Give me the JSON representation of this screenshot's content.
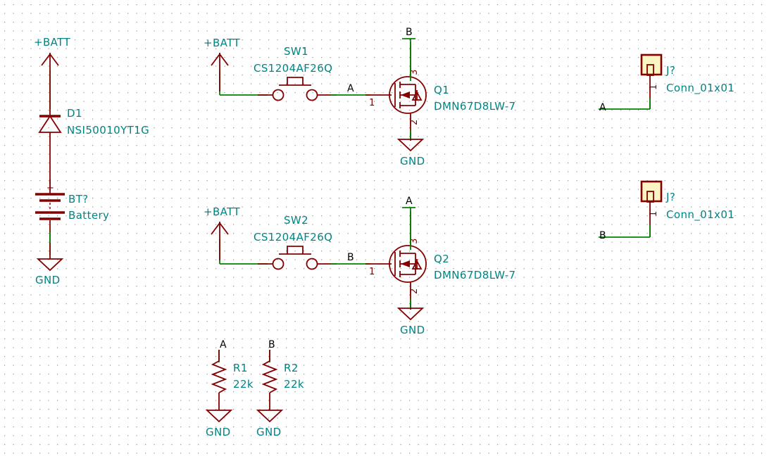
{
  "document": {
    "type": "schematic",
    "title": "KiCad Schematic Canvas",
    "background": "#ffffff",
    "grid_color": "#9a9a9a",
    "colors": {
      "component_text": "#008484",
      "symbol_outline": "#840000",
      "wire": "#008400",
      "label_text": "#000000",
      "pin_number": "#840000",
      "connector_fill": "#fbf5c4"
    }
  },
  "power_symbols": [
    {
      "name": "batt-1",
      "label": "+BATT"
    },
    {
      "name": "batt-2",
      "label": "+BATT"
    },
    {
      "name": "batt-3",
      "label": "+BATT"
    },
    {
      "name": "gnd-battery",
      "label": "GND"
    },
    {
      "name": "gnd-q1",
      "label": "GND"
    },
    {
      "name": "gnd-q2",
      "label": "GND"
    },
    {
      "name": "gnd-r1",
      "label": "GND"
    },
    {
      "name": "gnd-r2",
      "label": "GND"
    }
  ],
  "components": [
    {
      "id": "D1",
      "reference": "D1",
      "value": "NSI50010YT1G",
      "kind": "diode"
    },
    {
      "id": "BT1",
      "reference": "BT?",
      "value": "Battery",
      "kind": "battery",
      "polarity_marker": "+"
    },
    {
      "id": "SW1",
      "reference": "SW1",
      "value": "CS1204AF26Q",
      "kind": "push-button"
    },
    {
      "id": "SW2",
      "reference": "SW2",
      "value": "CS1204AF26Q",
      "kind": "push-button"
    },
    {
      "id": "Q1",
      "reference": "Q1",
      "value": "DMN67D8LW-7",
      "kind": "n-mosfet",
      "pins": {
        "gate": "1",
        "source": "2",
        "drain": "3"
      }
    },
    {
      "id": "Q2",
      "reference": "Q2",
      "value": "DMN67D8LW-7",
      "kind": "n-mosfet",
      "pins": {
        "gate": "1",
        "source": "2",
        "drain": "3"
      }
    },
    {
      "id": "R1",
      "reference": "R1",
      "value": "22k",
      "kind": "resistor"
    },
    {
      "id": "R2",
      "reference": "R2",
      "value": "22k",
      "kind": "resistor"
    },
    {
      "id": "J1",
      "reference": "J?",
      "value": "Conn_01x01",
      "kind": "connector",
      "pin_number": "1"
    },
    {
      "id": "J2",
      "reference": "J?",
      "value": "Conn_01x01",
      "kind": "connector",
      "pin_number": "1"
    }
  ],
  "net_labels": [
    {
      "name": "label-a-sw1",
      "text": "A"
    },
    {
      "name": "label-b-q1",
      "text": "B"
    },
    {
      "name": "label-a-j1",
      "text": "A"
    },
    {
      "name": "label-b-sw2",
      "text": "B"
    },
    {
      "name": "label-a-q2",
      "text": "A"
    },
    {
      "name": "label-b-j2",
      "text": "B"
    },
    {
      "name": "label-a-r1",
      "text": "A"
    },
    {
      "name": "label-b-r2",
      "text": "B"
    }
  ],
  "pin_numbers": {
    "q1_gate": "1",
    "q1_source": "2",
    "q1_drain": "3",
    "q2_gate": "1",
    "q2_source": "2",
    "q2_drain": "3",
    "j1_pin": "1",
    "j2_pin": "1"
  }
}
